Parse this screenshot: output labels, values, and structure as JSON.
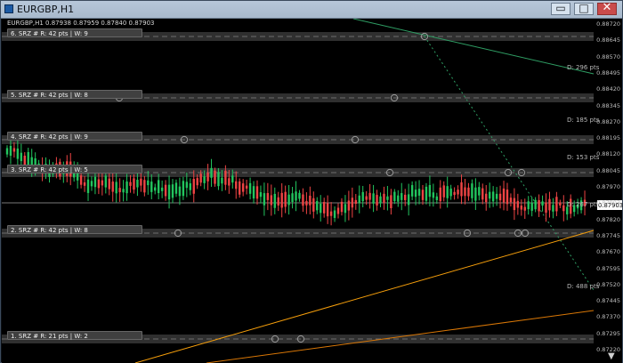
{
  "window": {
    "title": "EURGBP,H1",
    "buttons": {
      "minimize": "▭",
      "maximize": "□",
      "close": "✕"
    }
  },
  "chart": {
    "info_line": "EURGBP,H1  0.87938 0.87959 0.87840 0.87903",
    "current_price_label": "0.87903",
    "price_scale": [
      "0.88720",
      "0.88645",
      "0.88570",
      "0.88495",
      "0.88420",
      "0.88345",
      "0.88270",
      "0.88195",
      "0.88120",
      "0.88045",
      "0.87970",
      "0.87903",
      "0.87820",
      "0.87745",
      "0.87670",
      "0.87595",
      "0.87520",
      "0.87445",
      "0.87370",
      "0.87295",
      "0.87220"
    ],
    "levels": [
      {
        "label": "6. SRZ # R: 42 pts | W: 9"
      },
      {
        "label": "5. SRZ # R: 42 pts | W: 8"
      },
      {
        "label": "4. SRZ # R: 42 pts | W: 9"
      },
      {
        "label": "3. SRZ # R: 42 pts | W: 5"
      },
      {
        "label": "2. SRZ # R: 42 pts | W: 8"
      },
      {
        "label": "1. SRZ # R: 21 pts | W: 2"
      }
    ],
    "distances": [
      "D: 296 pts",
      "D: 185 pts",
      "D: 153 pts",
      "D: 267 pts",
      "D: 488 pts"
    ],
    "colors": {
      "up": "#22c55e",
      "down": "#ef4444",
      "bg": "#000000",
      "zone": "#3a3a3a",
      "trend": "#f59e0b",
      "green_line": "#2f9e64"
    },
    "scroll_icon": "arrow-down-icon"
  }
}
